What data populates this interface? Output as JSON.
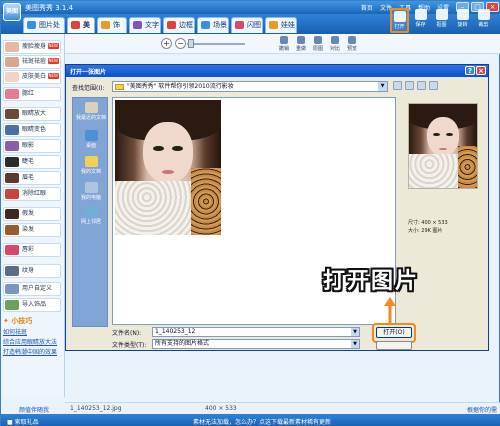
{
  "titlebar": {
    "title": "美图秀秀 3.1.4",
    "menus": [
      "首页",
      "文件",
      "工具",
      "帮助",
      "设置"
    ],
    "logo_text": "美图"
  },
  "tabs": [
    {
      "label": "图片处理",
      "active": false
    },
    {
      "label": "美容",
      "active": true
    },
    {
      "label": "饰品",
      "active": false
    },
    {
      "label": "文字",
      "active": false
    },
    {
      "label": "边框",
      "active": false
    },
    {
      "label": "场景",
      "active": false
    },
    {
      "label": "闪图",
      "active": false
    },
    {
      "label": "娃娃",
      "active": false
    }
  ],
  "tools": [
    {
      "label": "打开",
      "icon": "folder-open-icon",
      "highlighted": true
    },
    {
      "label": "保存",
      "icon": "save-icon",
      "highlighted": false
    },
    {
      "label": "抠图",
      "icon": "crop-icon",
      "highlighted": false
    },
    {
      "label": "旋转",
      "icon": "rotate-icon",
      "highlighted": false
    },
    {
      "label": "裁剪",
      "icon": "cut-icon",
      "highlighted": false
    }
  ],
  "subtools": [
    "撤销",
    "重做",
    "原图",
    "对比",
    "预览"
  ],
  "sidebar": {
    "effects": [
      {
        "label": "瘦脸瘦身",
        "new": true,
        "color": "#e8b9a2"
      },
      {
        "label": "祛斑祛痘",
        "new": true,
        "color": "#d9a78f"
      },
      {
        "label": "皮肤美白",
        "new": true,
        "color": "#f3d3c3"
      },
      {
        "label": "腮红",
        "new": false,
        "color": "#e77a93"
      },
      {
        "label": "眼睛放大",
        "new": false,
        "color": "#6b4a3a"
      },
      {
        "label": "眼睛变色",
        "new": false,
        "color": "#4a6fa6"
      },
      {
        "label": "眼影",
        "new": false,
        "color": "#8a5ea8"
      },
      {
        "label": "睫毛",
        "new": false,
        "color": "#2b2b2b"
      },
      {
        "label": "眉毛",
        "new": false,
        "color": "#5a3b2c"
      },
      {
        "label": "消除红眼",
        "new": false,
        "color": "#c8453b"
      },
      {
        "label": "假发",
        "new": false,
        "color": "#3a2a20"
      },
      {
        "label": "染发",
        "new": false,
        "color": "#9b5a2a"
      },
      {
        "label": "唇彩",
        "new": false,
        "color": "#d94868"
      },
      {
        "label": "纹身",
        "new": false,
        "color": "#5c6d86"
      },
      {
        "label": "用户自定义",
        "new": false,
        "color": "#7a97bf"
      },
      {
        "label": "导入饰品",
        "new": false,
        "color": "#6aa25a"
      }
    ],
    "tips_header": "小技巧",
    "tips": [
      "如何祛斑",
      "综合应用眼睛放大法",
      "打造韩潮中国的效果"
    ],
    "help_link": "颜值伴随我"
  },
  "dialog": {
    "title": "打开一张图片",
    "look_in_label": "查找范围(I):",
    "look_in_value": "\"美图秀秀\" 软件帮你引领2010流行影妆",
    "places": [
      {
        "label": "我最近的文档",
        "icon": "recent-docs-icon",
        "color": "#d9d2b8"
      },
      {
        "label": "桌面",
        "icon": "desktop-icon",
        "color": "#4f8fd8"
      },
      {
        "label": "我的文档",
        "icon": "my-docs-icon",
        "color": "#f2cf57"
      },
      {
        "label": "我的电脑",
        "icon": "my-computer-icon",
        "color": "#aec4e0"
      },
      {
        "label": "网上邻居",
        "icon": "network-icon",
        "color": "#6fb0d8"
      }
    ],
    "filename_label": "文件名(N):",
    "filename_value": "1_140253_12",
    "filetype_label": "文件类型(T):",
    "filetype_value": "所有支持的图片格式",
    "open_label": "打开(O)",
    "preview": {
      "size_text": "尺寸: 400 × 533",
      "filesize_text": "大小: 29K 图片"
    }
  },
  "callout": "打开图片",
  "statusbar": {
    "filename": "1_140253_12.jpg",
    "dimensions": "400 × 533"
  },
  "right_link": "根据你的需要",
  "bottombar": {
    "gift": "索取礼品",
    "ad": "素材无法加载，怎么办？点这下载最新素材稀有更新"
  }
}
